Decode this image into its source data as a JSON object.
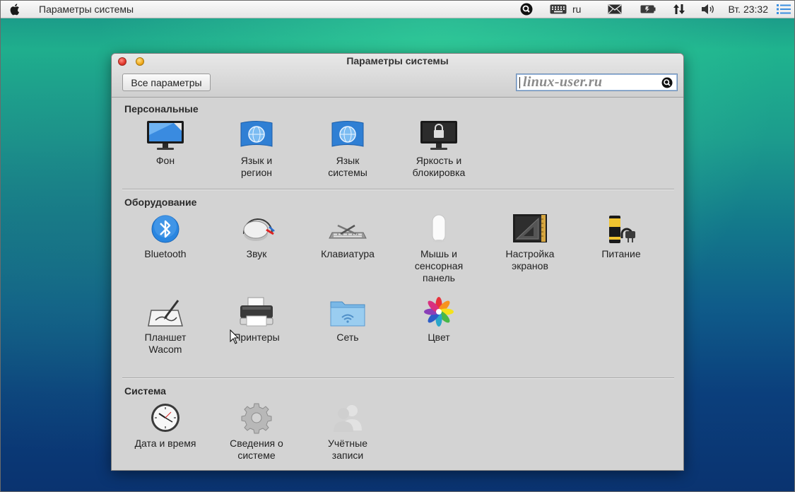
{
  "menubar": {
    "title": "Параметры системы",
    "layout_indicator": "ru",
    "clock": "Вт. 23:32",
    "icons": [
      "apple-icon",
      "search-circle-icon",
      "keyboard-icon",
      "mail-icon",
      "battery-icon",
      "network-icon",
      "volume-icon",
      "menu-list-icon"
    ]
  },
  "window": {
    "title": "Параметры системы",
    "all_button": "Все параметры",
    "search_value": "linux-user.ru"
  },
  "sections": {
    "personal": {
      "title": "Персональные",
      "items": [
        {
          "line1": "Фон",
          "line2": "",
          "icon": "wallpaper-monitor-icon"
        },
        {
          "line1": "Язык и",
          "line2": "регион",
          "icon": "flag-globe-icon"
        },
        {
          "line1": "Язык",
          "line2": "системы",
          "icon": "flag-globe-icon"
        },
        {
          "line1": "Яркость и",
          "line2": "блокировка",
          "icon": "lock-monitor-icon"
        }
      ]
    },
    "hardware": {
      "title": "Оборудование",
      "items": [
        {
          "line1": "Bluetooth",
          "line2": "",
          "line3": "",
          "icon": "bluetooth-icon"
        },
        {
          "line1": "Звук",
          "line2": "",
          "line3": "",
          "icon": "sound-knob-icon"
        },
        {
          "line1": "Клавиатура",
          "line2": "",
          "line3": "",
          "icon": "keyboard-tools-icon"
        },
        {
          "line1": "Мышь и",
          "line2": "сенсорная",
          "line3": "панель",
          "icon": "mouse-icon"
        },
        {
          "line1": "Настройка",
          "line2": "экранов",
          "line3": "",
          "icon": "display-ruler-icon"
        },
        {
          "line1": "Питание",
          "line2": "",
          "line3": "",
          "icon": "battery-plug-icon"
        },
        {
          "line1": "Планшет",
          "line2": "Wacom",
          "line3": "",
          "icon": "tablet-pen-icon"
        },
        {
          "line1": "Принтеры",
          "line2": "",
          "line3": "",
          "icon": "printer-icon"
        },
        {
          "line1": "Сеть",
          "line2": "",
          "line3": "",
          "icon": "network-folder-icon"
        },
        {
          "line1": "Цвет",
          "line2": "",
          "line3": "",
          "icon": "color-flower-icon"
        }
      ]
    },
    "system": {
      "title": "Система",
      "items": [
        {
          "line1": "Дата и время",
          "line2": "",
          "icon": "clock-icon"
        },
        {
          "line1": "Сведения о",
          "line2": "системе",
          "icon": "gear-icon"
        },
        {
          "line1": "Учётные",
          "line2": "записи",
          "icon": "users-icon"
        }
      ]
    }
  }
}
